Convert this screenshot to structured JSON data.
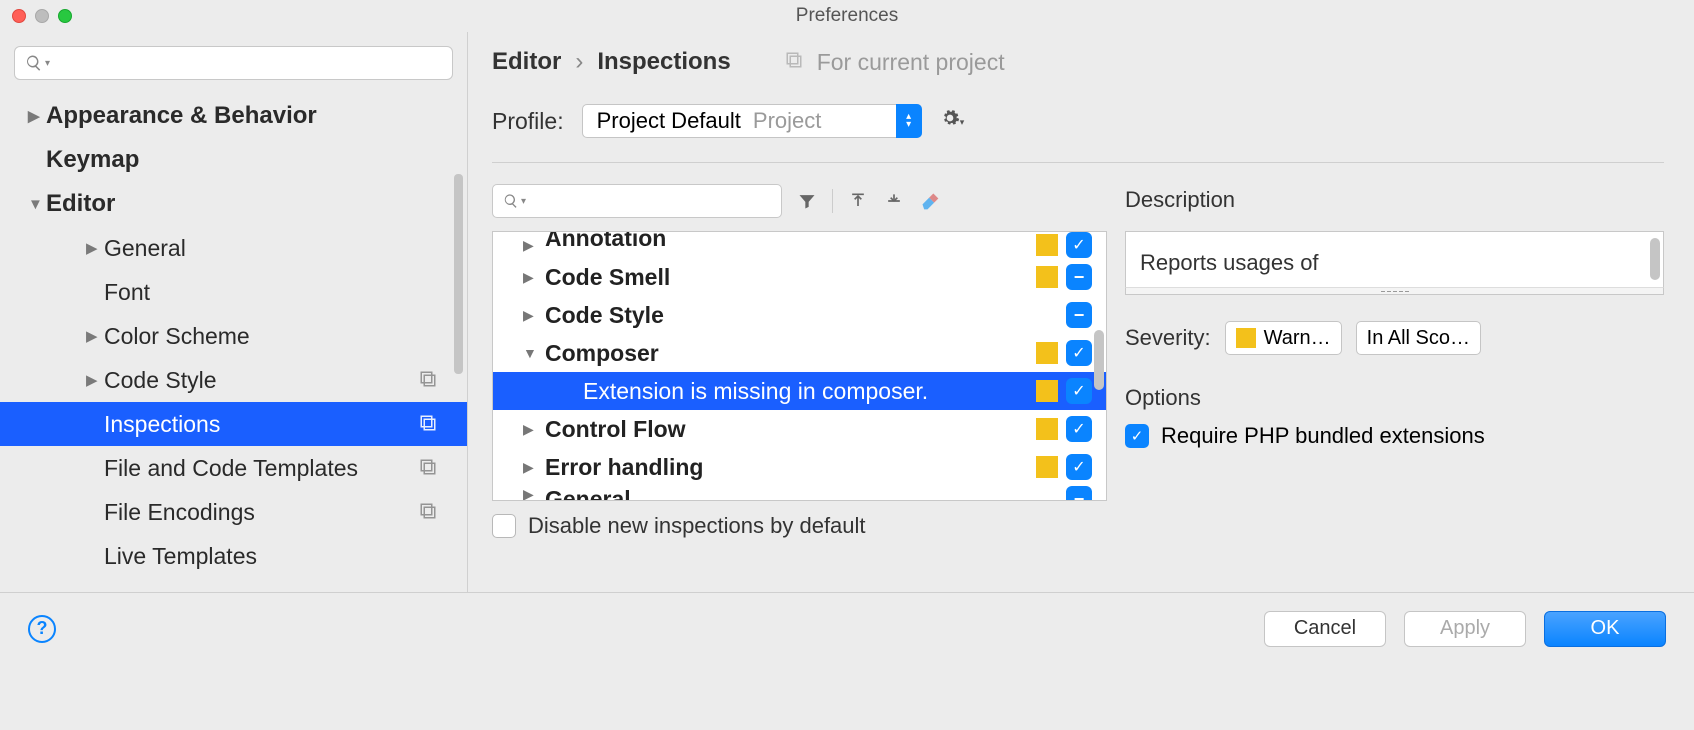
{
  "window": {
    "title": "Preferences"
  },
  "sidebar": {
    "items": [
      {
        "label": "Appearance & Behavior",
        "bold": true,
        "chev": "right",
        "indent": 0
      },
      {
        "label": "Keymap",
        "bold": true,
        "chev": "none",
        "indent": 0
      },
      {
        "label": "Editor",
        "bold": true,
        "chev": "down",
        "indent": 0
      },
      {
        "label": "General",
        "chev": "right",
        "indent": 1
      },
      {
        "label": "Font",
        "chev": "none",
        "indent": 1
      },
      {
        "label": "Color Scheme",
        "chev": "right",
        "indent": 1
      },
      {
        "label": "Code Style",
        "chev": "right",
        "indent": 1,
        "proj": true
      },
      {
        "label": "Inspections",
        "chev": "none",
        "indent": 1,
        "proj": true,
        "selected": true
      },
      {
        "label": "File and Code Templates",
        "chev": "none",
        "indent": 1,
        "proj": true
      },
      {
        "label": "File Encodings",
        "chev": "none",
        "indent": 1,
        "proj": true
      },
      {
        "label": "Live Templates",
        "chev": "none",
        "indent": 1
      }
    ]
  },
  "breadcrumb": {
    "crumb1": "Editor",
    "crumb2": "Inspections",
    "scope": "For current project"
  },
  "profile": {
    "label": "Profile:",
    "value": "Project Default",
    "tag": "Project"
  },
  "inspections": [
    {
      "label": "Annotation",
      "chev": "right",
      "sev": true,
      "cb": "check",
      "cut": true
    },
    {
      "label": "Code Smell",
      "chev": "right",
      "sev": true,
      "cb": "dash"
    },
    {
      "label": "Code Style",
      "chev": "right",
      "sev": false,
      "cb": "dash"
    },
    {
      "label": "Composer",
      "chev": "down",
      "sev": true,
      "cb": "check"
    },
    {
      "label": "Extension is missing in composer.",
      "child": true,
      "sev": true,
      "cb": "check",
      "selected": true
    },
    {
      "label": "Control Flow",
      "chev": "right",
      "sev": true,
      "cb": "check"
    },
    {
      "label": "Error handling",
      "chev": "right",
      "sev": true,
      "cb": "check"
    },
    {
      "label": "General",
      "chev": "right",
      "sev": false,
      "cb": "dash",
      "cutbottom": true
    }
  ],
  "disable_label": "Disable new inspections by default",
  "desc": {
    "heading": "Description",
    "text": "Reports usages of"
  },
  "severity": {
    "label": "Severity:",
    "value": "Warn…",
    "scope": "In All Sco…"
  },
  "options": {
    "heading": "Options",
    "require": "Require PHP bundled extensions"
  },
  "footer": {
    "cancel": "Cancel",
    "apply": "Apply",
    "ok": "OK"
  }
}
